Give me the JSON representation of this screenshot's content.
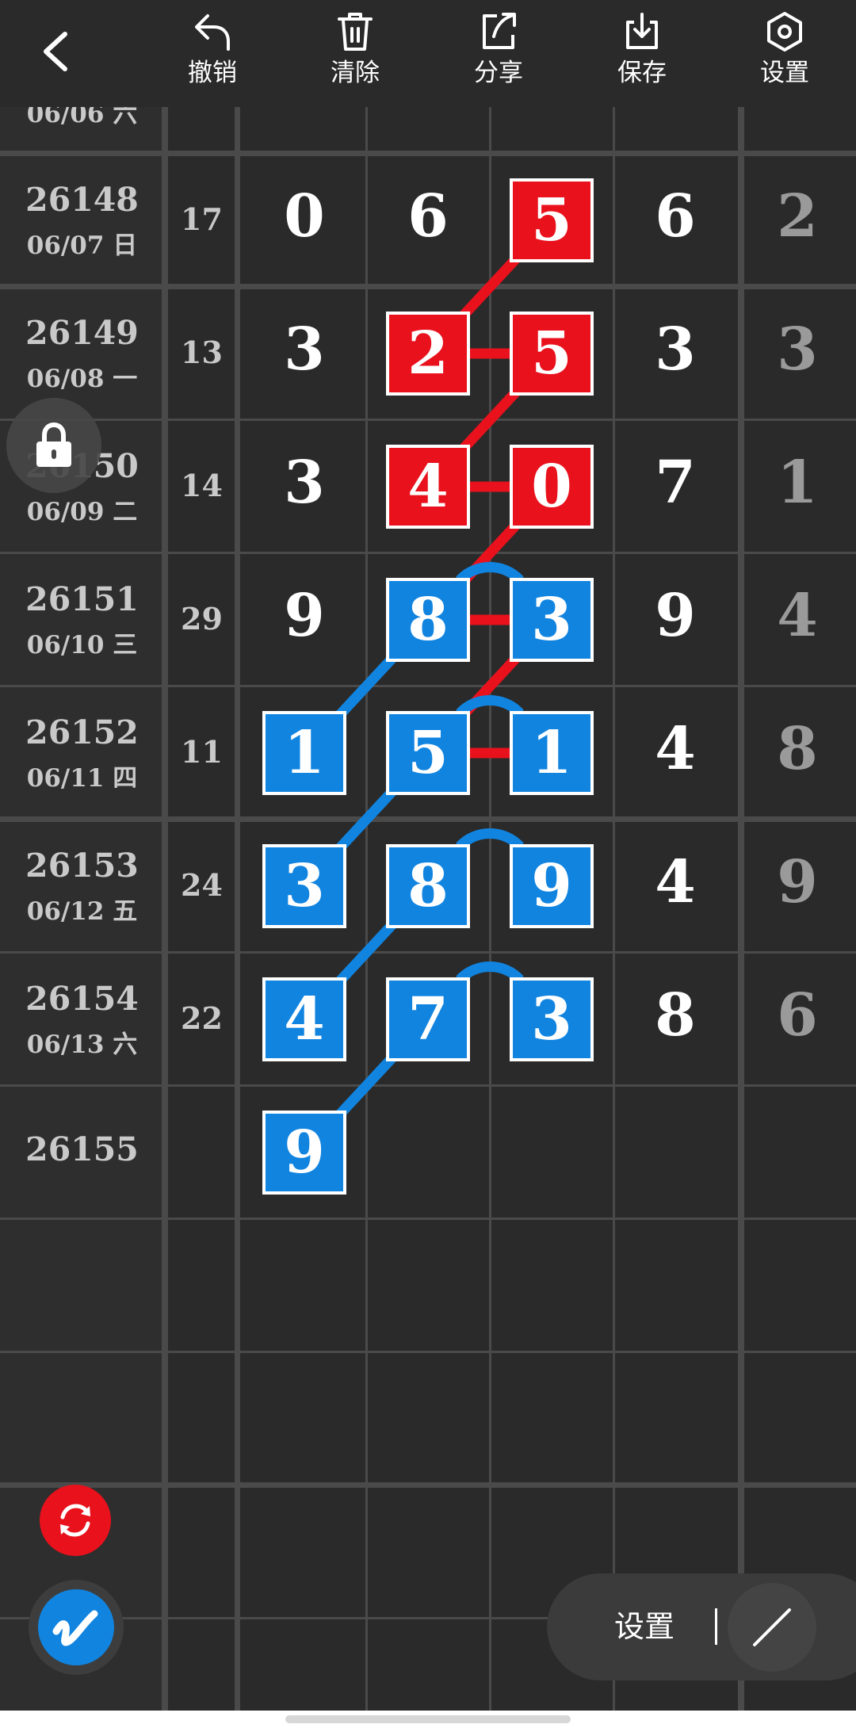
{
  "toolbar": {
    "back_icon": "chevron-left-icon",
    "actions": [
      {
        "label": "撤销",
        "icon": "undo-icon"
      },
      {
        "label": "清除",
        "icon": "trash-icon"
      },
      {
        "label": "分享",
        "icon": "share-icon"
      },
      {
        "label": "保存",
        "icon": "download-icon"
      },
      {
        "label": "设置",
        "icon": "hexagon-gear-icon"
      }
    ]
  },
  "table": {
    "partial_top_row_date": "06/06 六",
    "rows": [
      {
        "id": "26148",
        "date": "06/07 日",
        "sum": "17",
        "digits": [
          "0",
          "6",
          "5",
          "6",
          "2"
        ]
      },
      {
        "id": "26149",
        "date": "06/08 一",
        "sum": "13",
        "digits": [
          "3",
          "2",
          "5",
          "3",
          "3"
        ]
      },
      {
        "id": "26150",
        "date": "06/09 二",
        "sum": "14",
        "digits": [
          "3",
          "4",
          "0",
          "7",
          "1"
        ]
      },
      {
        "id": "26151",
        "date": "06/10 三",
        "sum": "29",
        "digits": [
          "9",
          "8",
          "3",
          "9",
          "4"
        ]
      },
      {
        "id": "26152",
        "date": "06/11 四",
        "sum": "11",
        "digits": [
          "1",
          "5",
          "1",
          "4",
          "8"
        ]
      },
      {
        "id": "26153",
        "date": "06/12 五",
        "sum": "24",
        "digits": [
          "3",
          "8",
          "9",
          "4",
          "9"
        ]
      },
      {
        "id": "26154",
        "date": "06/13 六",
        "sum": "22",
        "digits": [
          "4",
          "7",
          "3",
          "8",
          "6"
        ]
      },
      {
        "id": "26155",
        "date": "",
        "sum": "",
        "digits": [
          "9",
          "",
          "",
          "",
          ""
        ]
      }
    ]
  },
  "highlights": {
    "colors": {
      "red": "#e8111c",
      "blue": "#1184e0",
      "box_border": "#ffffff"
    },
    "red_boxes": [
      {
        "row": 0,
        "col": 2
      },
      {
        "row": 1,
        "col": 1
      },
      {
        "row": 1,
        "col": 2
      },
      {
        "row": 2,
        "col": 1
      },
      {
        "row": 2,
        "col": 2
      }
    ],
    "blue_boxes": [
      {
        "row": 3,
        "col": 1
      },
      {
        "row": 3,
        "col": 2
      },
      {
        "row": 4,
        "col": 0
      },
      {
        "row": 4,
        "col": 1
      },
      {
        "row": 4,
        "col": 2
      },
      {
        "row": 5,
        "col": 0
      },
      {
        "row": 5,
        "col": 1
      },
      {
        "row": 5,
        "col": 2
      },
      {
        "row": 6,
        "col": 0
      },
      {
        "row": 6,
        "col": 1
      },
      {
        "row": 6,
        "col": 2
      },
      {
        "row": 7,
        "col": 0
      }
    ]
  },
  "floating": {
    "lock_icon": "lock-icon",
    "refresh_icon": "refresh-icon",
    "pen_icon": "pen-logo-icon",
    "settings_pill_label": "设置",
    "line_tool_icon": "line-tool-icon"
  }
}
